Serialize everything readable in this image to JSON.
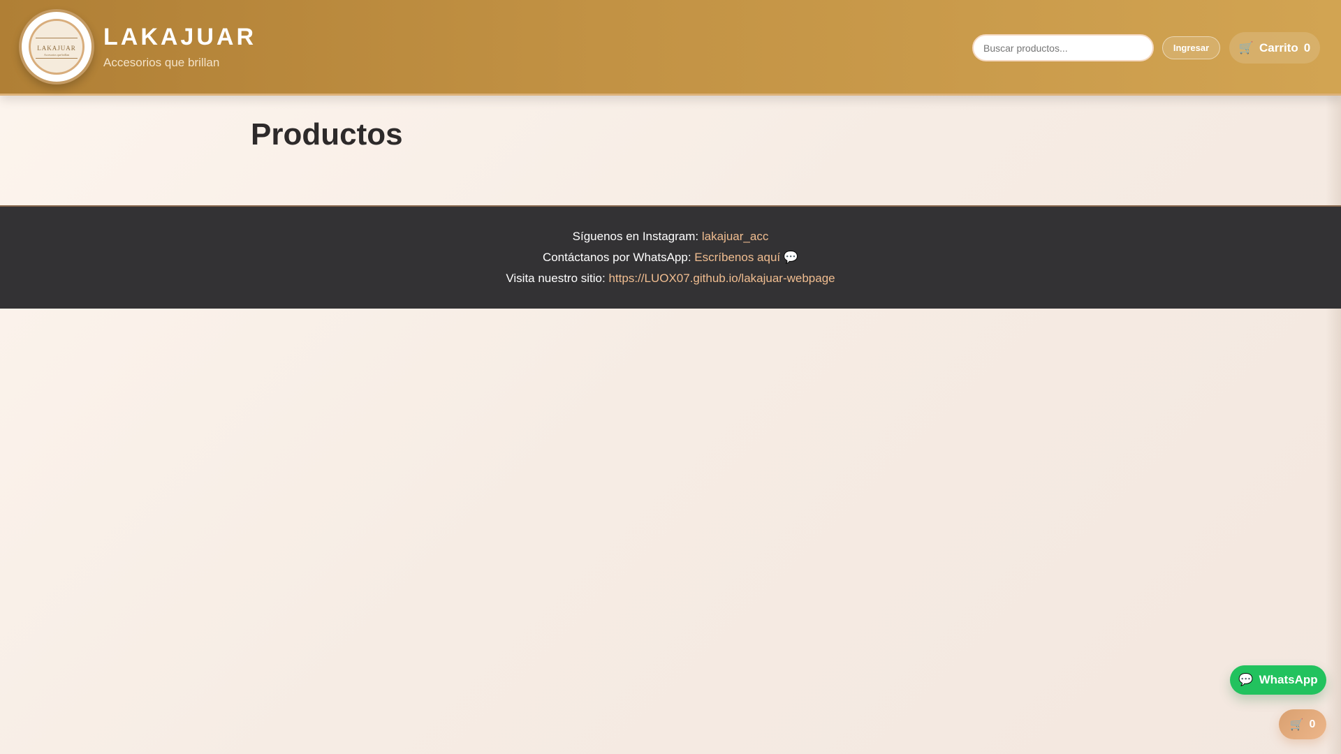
{
  "header": {
    "logo_text": "LAKAJUAR",
    "logo_subtext": "Accesorios que brillan",
    "brand": "LAKAJUAR",
    "tagline": "Accesorios que brillan",
    "search_placeholder": "Buscar productos...",
    "login_label": "Ingresar",
    "cart_icon": "🛒",
    "cart_label": "Carrito",
    "cart_count": "0"
  },
  "main": {
    "title": "Productos"
  },
  "footer": {
    "instagram_prefix": "Síguenos en Instagram:",
    "instagram_link": "lakajuar_acc",
    "whatsapp_prefix": "Contáctanos por WhatsApp:",
    "whatsapp_link": "Escríbenos aquí",
    "whatsapp_icon": "💬",
    "site_prefix": "Visita nuestro sitio:",
    "site_link": "https://LUOX07.github.io/lakajuar-webpage"
  },
  "floating": {
    "whatsapp_icon": "💬",
    "whatsapp_label": "WhatsApp",
    "cart_icon": "🛒",
    "cart_count": "0"
  }
}
